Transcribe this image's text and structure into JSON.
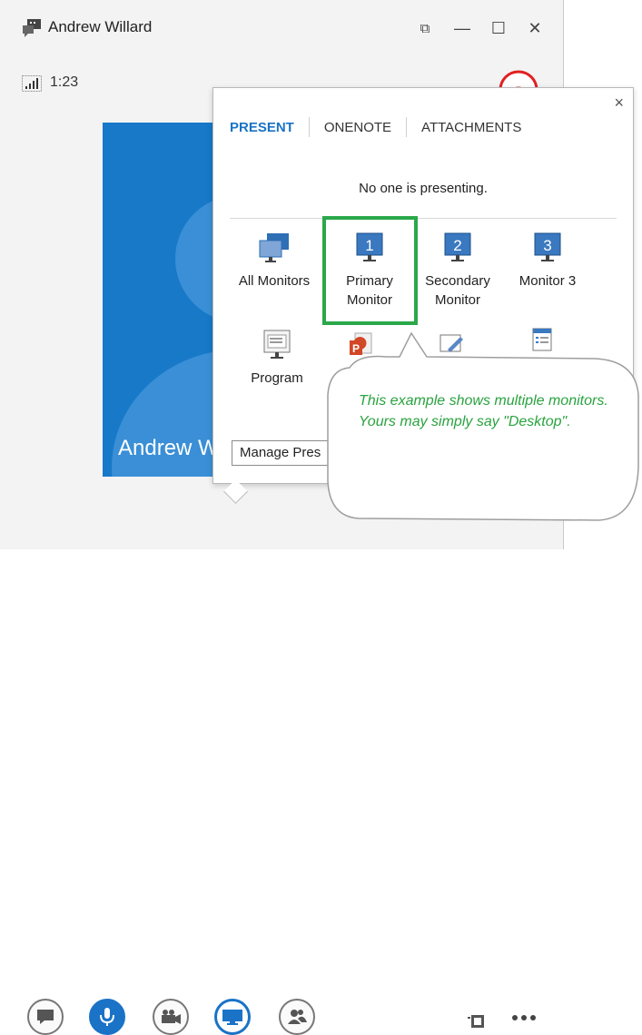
{
  "window": {
    "title": "Andrew Willard",
    "timer": "1:23",
    "participant_name": "Andrew W",
    "buttons": {
      "restore": "⧉",
      "minimize": "—",
      "maximize": "☐",
      "close": "✕"
    }
  },
  "popup": {
    "close": "×",
    "tabs": [
      {
        "label": "PRESENT",
        "active": true
      },
      {
        "label": "ONENOTE",
        "active": false
      },
      {
        "label": "ATTACHMENTS",
        "active": false
      }
    ],
    "status": "No one is presenting.",
    "options": [
      {
        "label": "All Monitors"
      },
      {
        "label": "Primary Monitor",
        "number": "1"
      },
      {
        "label": "Secondary Monitor",
        "number": "2"
      },
      {
        "label": "Monitor 3",
        "number": "3"
      },
      {
        "label": "Program"
      }
    ],
    "manage_label": "Manage Pres"
  },
  "callout": {
    "text": "This example shows multiple monitors. Yours may simply say \"Desktop\"."
  },
  "toolbar": {
    "icons": [
      "chat-icon",
      "microphone-icon",
      "video-camera-icon",
      "monitor-icon",
      "participants-icon"
    ]
  },
  "colors": {
    "accent": "#1a73c6",
    "video_tile": "#1779c8",
    "highlight": "#2aa84a",
    "callout_text": "#29a33f",
    "hangup": "#e02020"
  }
}
